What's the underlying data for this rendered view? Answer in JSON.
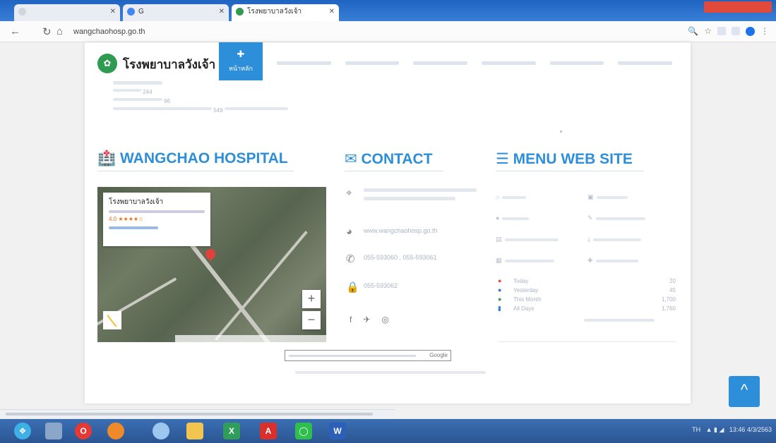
{
  "browser": {
    "tabs": [
      {
        "title": "",
        "active": false
      },
      {
        "title": "G",
        "active": false
      },
      {
        "title": "โรงพยาบาลวังเจ้า",
        "active": true
      }
    ],
    "address": {
      "url": "wangchaohosp.go.th"
    },
    "colors": {
      "tabbar": "#2f72cc",
      "accent": "#2d8fd9"
    }
  },
  "site": {
    "title": "โรงพยาบาลวังเจ้า",
    "home_label": "หน้าหลัก",
    "stats_lines": [
      "",
      "244",
      "96",
      "549"
    ]
  },
  "sections": {
    "about_title": "WANGCHAO HOSPITAL",
    "contact_title": "CONTACT",
    "menu_title": "MENU WEB SITE"
  },
  "map": {
    "place_name": "โรงพยาบาลวังเจ้า",
    "rating": "4.0 ★★★★☆",
    "zoom_in": "+",
    "zoom_out": "−"
  },
  "contact": {
    "website": "www.wangchaohosp.go.th",
    "phone": "055-593060 , 055-593061",
    "fax": "055-593062"
  },
  "counter": {
    "rows": [
      {
        "label": "Today",
        "value": "20"
      },
      {
        "label": "Yesterday",
        "value": "45"
      },
      {
        "label": "This Month",
        "value": "1,700"
      },
      {
        "label": "All Days",
        "value": "1,760"
      }
    ]
  },
  "footer": {
    "google_note": "Google",
    "to_top": "^"
  },
  "taskbar": {
    "word": "W",
    "tray_time": "13:46",
    "tray_date": "4/3/2563",
    "tray_lang": "TH"
  }
}
